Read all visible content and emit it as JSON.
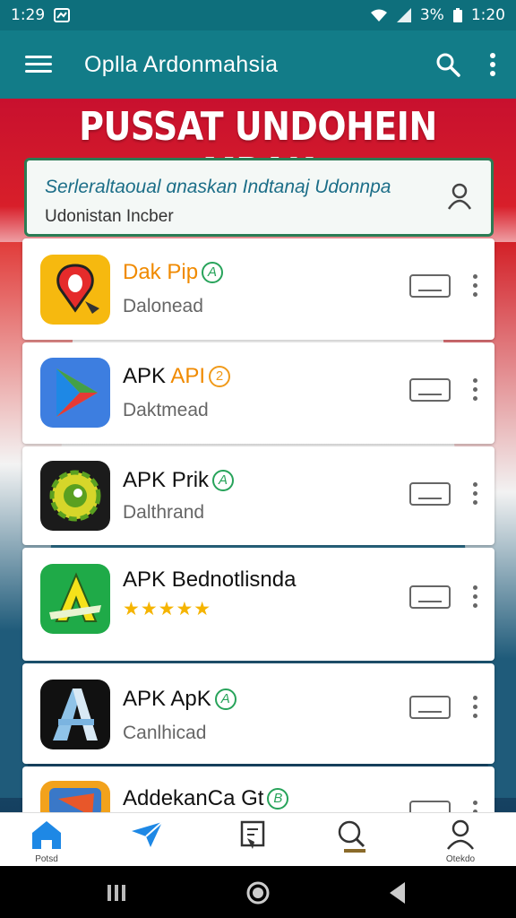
{
  "status_bar": {
    "time_left": "1:29",
    "battery": "3%",
    "time_right": "1:20"
  },
  "app_bar": {
    "title": "Oplla Ardonmahsia"
  },
  "banner": {
    "title": "PUSSAT UNDOHEIN MRAK"
  },
  "search_card": {
    "line1": "Serleraltaoual ɑnaskan Indtanaj Udonnpa",
    "line2": "Udonistan Incber"
  },
  "apps": [
    {
      "name": "Dak Pip",
      "badge": "A",
      "badge_color": "#27a35a",
      "subtitle": "Dalonead",
      "icon": "red-pin-app-icon"
    },
    {
      "name": "APK API",
      "badge": "2",
      "badge_color": "#f09a1a",
      "subtitle": "Daktmead",
      "icon": "play-triangle-app-icon"
    },
    {
      "name": "APK Prik",
      "badge": "A",
      "badge_color": "#27a35a",
      "subtitle": "Dalthrand",
      "icon": "green-gear-app-icon"
    },
    {
      "name": "APK Bednotlisnda",
      "badge": "",
      "subtitle": "",
      "rating": "★★★★★",
      "icon": "green-a-app-icon"
    },
    {
      "name": "APK ApK",
      "badge": "A",
      "badge_color": "#27a35a",
      "subtitle": "Canlhicad",
      "icon": "blue-a-app-icon"
    },
    {
      "name": "AddekanCa Gt",
      "badge": "B",
      "badge_color": "#27a35a",
      "subtitle": "",
      "icon": "orange-app-icon"
    }
  ],
  "bottom_nav": [
    {
      "label": "Potsd",
      "icon": "home-icon"
    },
    {
      "label": "",
      "icon": "send-icon"
    },
    {
      "label": "",
      "icon": "book-icon"
    },
    {
      "label": "",
      "icon": "search-icon"
    },
    {
      "label": "Otekdo",
      "icon": "profile-icon"
    }
  ],
  "colors": {
    "app_bar": "#127c88",
    "status_bar": "#0e6f7c",
    "banner_red": "#c8102e",
    "accent_green": "#27a35a",
    "accent_blue": "#1e88e5"
  }
}
